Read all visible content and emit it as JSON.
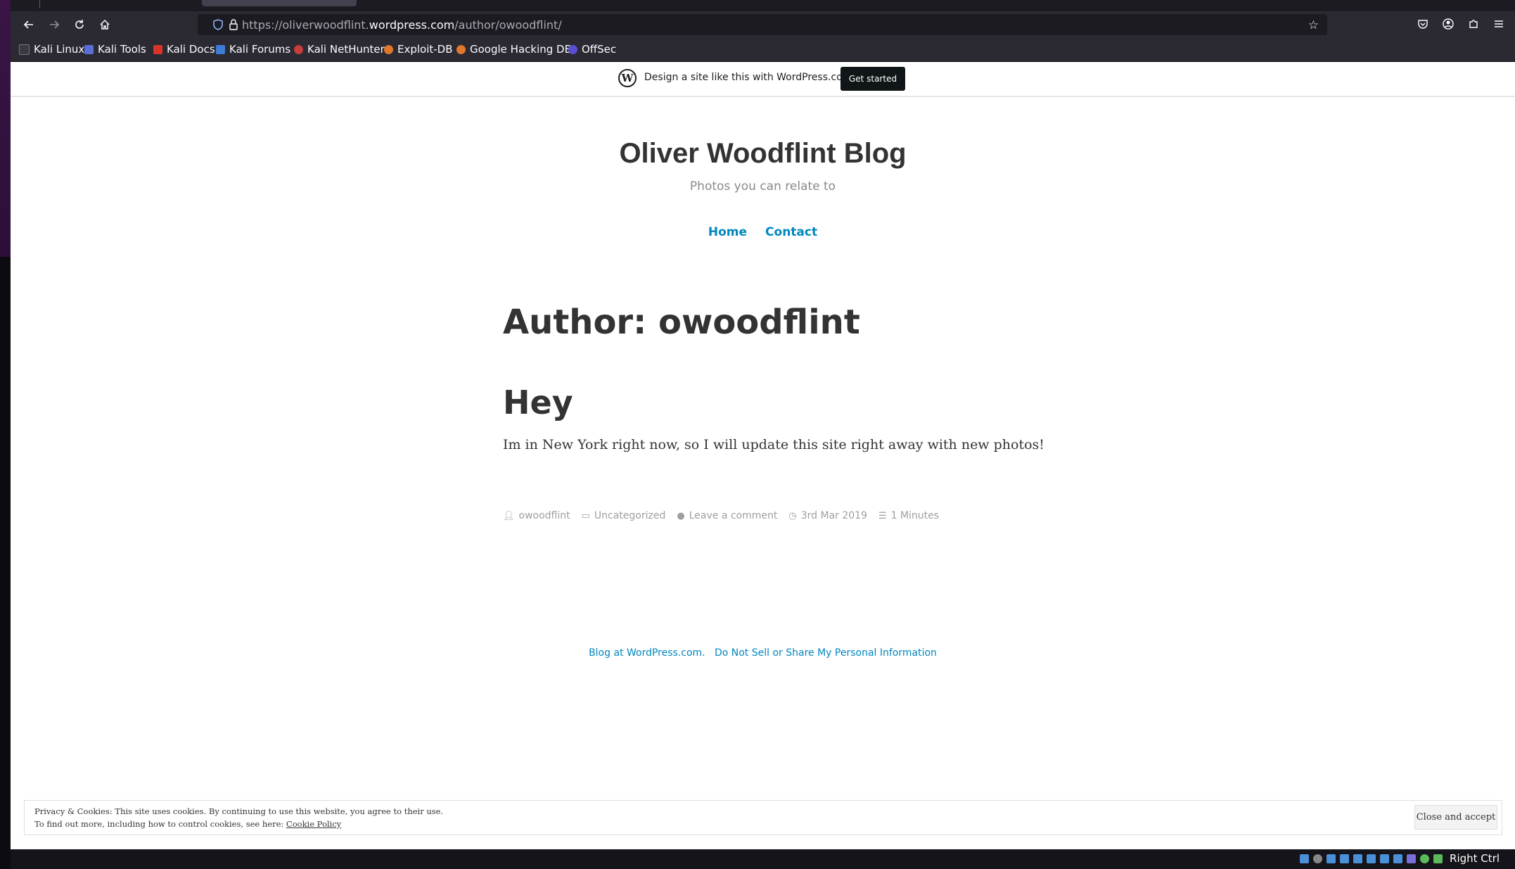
{
  "browser": {
    "url_prefix": "https://oliverwoodflint.",
    "url_host": "wordpress.com",
    "url_path": "/author/owoodflint/",
    "bookmarks": [
      "Kali Linux",
      "Kali Tools",
      "Kali Docs",
      "Kali Forums",
      "Kali NetHunter",
      "Exploit-DB",
      "Google Hacking DB",
      "OffSec"
    ]
  },
  "wpbar": {
    "text": "Design a site like this with WordPress.com",
    "button": "Get started"
  },
  "site": {
    "title": "Oliver Woodflint Blog",
    "description": "Photos you can relate to",
    "menu": [
      "Home",
      "Contact"
    ]
  },
  "archive": {
    "heading": "Author: owoodflint"
  },
  "post": {
    "title": "Hey",
    "body": "Im in New York right now, so I will update this site right away with new photos!",
    "meta": {
      "author": "owoodflint",
      "category": "Uncategorized",
      "comments": "Leave a comment",
      "date": "3rd Mar 2019",
      "read_time": "1 Minutes"
    }
  },
  "footer": {
    "blog_link": "Blog at WordPress.com.",
    "privacy_link": "Do Not Sell or Share My Personal Information"
  },
  "cookie": {
    "line1": "Privacy & Cookies: This site uses cookies. By continuing to use this website, you agree to their use.",
    "line2_prefix": "To find out more, including how to control cookies, see here: ",
    "policy_link": "Cookie Policy",
    "button": "Close and accept"
  },
  "taskbar": {
    "keyboard_label": "Right Ctrl"
  },
  "colors": {
    "link": "#0087be",
    "browser_chrome": "#2b2a33"
  }
}
